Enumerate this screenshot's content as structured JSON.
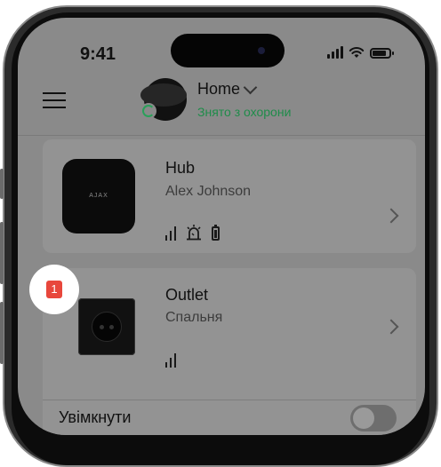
{
  "status_bar": {
    "time": "9:41",
    "icons": [
      "signal-icon",
      "wifi-icon",
      "battery-icon"
    ]
  },
  "header": {
    "menu_icon": "hamburger-menu-icon",
    "hub_name": "Home",
    "arm_status": "Знято з охорони",
    "arm_status_color": "#1f8c4a",
    "icons": [
      "chevron-down-icon",
      "disarmed-icon"
    ]
  },
  "devices": [
    {
      "name": "Hub",
      "subtitle": "Alex Johnson",
      "image_label": "AJAX",
      "status_icons": [
        "signal-strength-icon",
        "siren-icon",
        "battery-icon"
      ]
    },
    {
      "name": "Outlet",
      "subtitle": "Спальня",
      "status_icons": [
        "signal-strength-icon"
      ],
      "toggle_label": "Увімкнути",
      "toggle_on": false
    }
  ],
  "tutorial_badge": {
    "number": "1",
    "color": "#e8473c"
  }
}
